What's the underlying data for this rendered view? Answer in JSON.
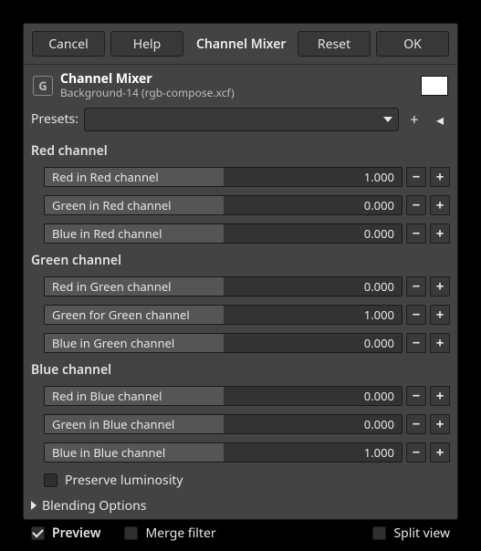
{
  "topbar": {
    "cancel": "Cancel",
    "help": "Help",
    "title": "Channel Mixer",
    "reset": "Reset",
    "ok": "OK"
  },
  "header": {
    "title": "Channel Mixer",
    "subtitle": "Background-14 (rgb-compose.xcf)",
    "swatch_color": "#ffffff"
  },
  "presets": {
    "label": "Presets:",
    "selected": ""
  },
  "sections": {
    "red": {
      "label": "Red channel"
    },
    "green": {
      "label": "Green channel"
    },
    "blue": {
      "label": "Blue channel"
    }
  },
  "sliders": {
    "red_red": {
      "label": "Red in Red channel",
      "value": "1.000",
      "fill_pct": 50
    },
    "red_green": {
      "label": "Green in Red channel",
      "value": "0.000",
      "fill_pct": 50
    },
    "red_blue": {
      "label": "Blue in Red channel",
      "value": "0.000",
      "fill_pct": 50
    },
    "green_red": {
      "label": "Red in Green channel",
      "value": "0.000",
      "fill_pct": 50
    },
    "green_green": {
      "label": "Green for Green channel",
      "value": "1.000",
      "fill_pct": 50
    },
    "green_blue": {
      "label": "Blue in Green channel",
      "value": "0.000",
      "fill_pct": 50
    },
    "blue_red": {
      "label": "Red in Blue channel",
      "value": "0.000",
      "fill_pct": 50
    },
    "blue_green": {
      "label": "Green in Blue channel",
      "value": "0.000",
      "fill_pct": 50
    },
    "blue_blue": {
      "label": "Blue in Blue channel",
      "value": "1.000",
      "fill_pct": 50
    }
  },
  "options": {
    "preserve_luminosity": {
      "label": "Preserve luminosity",
      "checked": false
    },
    "blending": {
      "label": "Blending Options"
    },
    "preview": {
      "label": "Preview",
      "checked": true
    },
    "merge_filter": {
      "label": "Merge filter",
      "checked": false
    },
    "split_view": {
      "label": "Split view",
      "checked": false
    }
  },
  "icons": {
    "plus": "+",
    "minus": "−",
    "add_preset": "+",
    "manage_preset": "◂"
  }
}
